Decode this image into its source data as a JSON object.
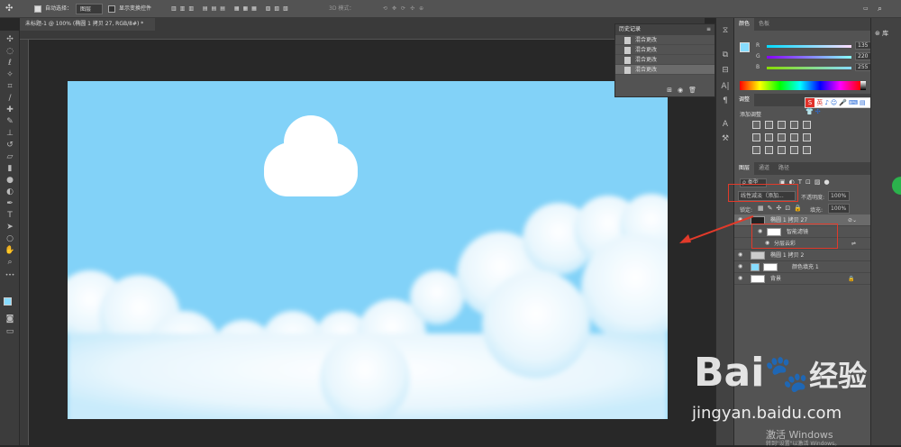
{
  "options_bar": {
    "auto_select_label": "自动选择：",
    "auto_select_value": "图层",
    "show_transform_label": "显示变换控件",
    "mode_3d_label": "3D 模式："
  },
  "document_tab": {
    "title": "未标题-1 @ 100% (椭圆 1 拷贝 27, RGB/8#) *",
    "close": "×"
  },
  "history_panel": {
    "title": "历史记录",
    "items": [
      "混合更改",
      "混合更改",
      "混合更改",
      "混合更改"
    ]
  },
  "color_panel": {
    "tabs": [
      "颜色",
      "色板"
    ],
    "channels": [
      {
        "label": "R",
        "value": "135"
      },
      {
        "label": "G",
        "value": "220"
      },
      {
        "label": "B",
        "value": "255"
      }
    ],
    "foreground_color": "#87dcff"
  },
  "adjustments_panel": {
    "tab": "调整",
    "add_label": "添加调整"
  },
  "layers_panel": {
    "tabs": [
      "图层",
      "通道",
      "路径"
    ],
    "filter_label": "ρ 类型",
    "blend_mode": "线性减淡（添加...",
    "opacity_label": "不透明度:",
    "opacity_value": "100%",
    "lock_label": "锁定:",
    "fill_label": "填充:",
    "fill_value": "100%",
    "layers": [
      {
        "name": "椭圆 1 拷贝 27"
      },
      {
        "name": "智能滤镜"
      },
      {
        "name": "分层云彩"
      },
      {
        "name": "椭圆 1 拷贝 2"
      },
      {
        "name": "颜色填充 1"
      },
      {
        "name": "背景"
      }
    ]
  },
  "ime_toolbar": {
    "label": "英"
  },
  "watermark": {
    "brand": "Bai",
    "brand_suffix": "经验",
    "url": "jingyan.baidu.com",
    "os_text": "激活 Windows",
    "os_sub": "转到\"设置\"以激活 Windows。"
  },
  "far_strip": {
    "library_label": "库"
  },
  "colors": {
    "canvas_sky": "#82d2f8",
    "annotation_red": "#e23a2a",
    "green_badge": "#2bb24c"
  }
}
